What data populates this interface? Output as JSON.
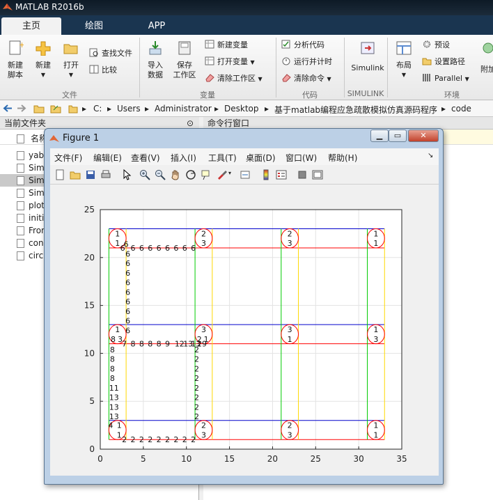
{
  "app": {
    "title": "MATLAB R2016b"
  },
  "tabs": [
    {
      "label": "主页",
      "active": true
    },
    {
      "label": "绘图",
      "active": false
    },
    {
      "label": "APP",
      "active": false
    }
  ],
  "ribbon": {
    "new_script": "新建\n脚本",
    "new": "新建",
    "open": "打开",
    "find_files": "查找文件",
    "compare": "比较",
    "import_data": "导入\n数据",
    "save_workspace": "保存\n工作区",
    "new_variable": "新建变量",
    "open_variable": "打开变量",
    "clear_workspace": "清除工作区",
    "analyze_code": "分析代码",
    "run_and_time": "运行并计时",
    "clear_commands": "清除命令",
    "simulink": "Simulink",
    "layout": "布局",
    "preferences": "预设",
    "set_path": "设置路径",
    "parallel": "Parallel",
    "addons": "附加",
    "groups": {
      "file": "文件",
      "variable": "变量",
      "code": "代码",
      "simulink": "SIMULINK",
      "environment": "环境"
    }
  },
  "address": {
    "crumbs": [
      "C:",
      "Users",
      "Administrator",
      "Desktop",
      "基于matlab编程应急疏散模拟仿真源码程序",
      "code"
    ]
  },
  "current_folder": {
    "header": "当前文件夹",
    "name_col": "名称",
    "files": [
      "yab",
      "Sim",
      "Sim",
      "Sim",
      "plot",
      "initi",
      "Fron",
      "con",
      "circ"
    ],
    "selected_index": 2
  },
  "command_window": {
    "header": "命令行窗口"
  },
  "figure": {
    "title": "Figure 1",
    "menu": [
      "文件(F)",
      "编辑(E)",
      "查看(V)",
      "插入(I)",
      "工具(T)",
      "桌面(D)",
      "窗口(W)",
      "帮助(H)"
    ],
    "toolbar_icons": [
      "new-figure-icon",
      "open-icon",
      "save-icon",
      "print-icon",
      "pointer-icon",
      "zoom-in-icon",
      "zoom-out-icon",
      "pan-icon",
      "rotate-icon",
      "data-cursor-icon",
      "brush-icon",
      "link-icon",
      "colorbar-icon",
      "legend-icon",
      "hide-tools-icon",
      "dock-icon"
    ]
  },
  "chart_data": {
    "type": "scatter",
    "title": "",
    "xlabel": "",
    "ylabel": "",
    "xlim": [
      0,
      35
    ],
    "ylim": [
      0,
      25
    ],
    "xticks": [
      0,
      5,
      10,
      15,
      20,
      25,
      30,
      35
    ],
    "yticks": [
      0,
      5,
      10,
      15,
      20,
      25
    ],
    "grid": true,
    "lines": [
      {
        "color": "#0000cc",
        "x": [
          1,
          33
        ],
        "y": [
          23,
          23
        ]
      },
      {
        "color": "#ff0000",
        "x": [
          1,
          33
        ],
        "y": [
          21,
          21
        ]
      },
      {
        "color": "#0000cc",
        "x": [
          1,
          33
        ],
        "y": [
          13,
          13
        ]
      },
      {
        "color": "#ff0000",
        "x": [
          1,
          33
        ],
        "y": [
          11,
          11
        ]
      },
      {
        "color": "#0000cc",
        "x": [
          1,
          33
        ],
        "y": [
          3,
          3
        ]
      },
      {
        "color": "#ff0000",
        "x": [
          1,
          33
        ],
        "y": [
          1,
          1
        ]
      },
      {
        "color": "#00cc00",
        "x": [
          1,
          1
        ],
        "y": [
          1,
          23
        ]
      },
      {
        "color": "#ffd800",
        "x": [
          3,
          3
        ],
        "y": [
          1,
          23
        ]
      },
      {
        "color": "#00cc00",
        "x": [
          11,
          11
        ],
        "y": [
          1,
          23
        ]
      },
      {
        "color": "#ffd800",
        "x": [
          13,
          13
        ],
        "y": [
          1,
          23
        ]
      },
      {
        "color": "#00cc00",
        "x": [
          21,
          21
        ],
        "y": [
          1,
          23
        ]
      },
      {
        "color": "#ffd800",
        "x": [
          23,
          23
        ],
        "y": [
          1,
          23
        ]
      },
      {
        "color": "#00cc00",
        "x": [
          31,
          31
        ],
        "y": [
          1,
          23
        ]
      },
      {
        "color": "#ffd800",
        "x": [
          33,
          33
        ],
        "y": [
          1,
          23
        ]
      }
    ],
    "circles": [
      {
        "cx": 2,
        "cy": 22,
        "r": 1
      },
      {
        "cx": 12,
        "cy": 22,
        "r": 1
      },
      {
        "cx": 22,
        "cy": 22,
        "r": 1
      },
      {
        "cx": 32,
        "cy": 22,
        "r": 1
      },
      {
        "cx": 2,
        "cy": 12,
        "r": 1
      },
      {
        "cx": 12,
        "cy": 12,
        "r": 1
      },
      {
        "cx": 22,
        "cy": 12,
        "r": 1
      },
      {
        "cx": 32,
        "cy": 12,
        "r": 1
      },
      {
        "cx": 2,
        "cy": 2,
        "r": 1
      },
      {
        "cx": 12,
        "cy": 2,
        "r": 1
      },
      {
        "cx": 22,
        "cy": 2,
        "r": 1
      },
      {
        "cx": 32,
        "cy": 2,
        "r": 1
      }
    ],
    "labels": [
      {
        "x": 2,
        "y": 22.5,
        "t": "1"
      },
      {
        "x": 2,
        "y": 21.5,
        "t": "1"
      },
      {
        "x": 12,
        "y": 22.5,
        "t": "2"
      },
      {
        "x": 12,
        "y": 21.5,
        "t": "3"
      },
      {
        "x": 22,
        "y": 22.5,
        "t": "2"
      },
      {
        "x": 22,
        "y": 21.5,
        "t": "3"
      },
      {
        "x": 32,
        "y": 22.5,
        "t": "1"
      },
      {
        "x": 32,
        "y": 21.5,
        "t": "1"
      },
      {
        "x": 2,
        "y": 12.5,
        "t": "1"
      },
      {
        "x": 1.5,
        "y": 11.5,
        "t": "8"
      },
      {
        "x": 2.3,
        "y": 11.5,
        "t": "3"
      },
      {
        "x": 12,
        "y": 12.5,
        "t": "3"
      },
      {
        "x": 11.5,
        "y": 11.5,
        "t": "2"
      },
      {
        "x": 12.3,
        "y": 11.5,
        "t": "1"
      },
      {
        "x": 22,
        "y": 12.5,
        "t": "3"
      },
      {
        "x": 22,
        "y": 11.5,
        "t": "1"
      },
      {
        "x": 32,
        "y": 12.5,
        "t": "1"
      },
      {
        "x": 32,
        "y": 11.5,
        "t": "3"
      },
      {
        "x": 1.2,
        "y": 2.5,
        "t": "4"
      },
      {
        "x": 2.2,
        "y": 2.5,
        "t": "1"
      },
      {
        "x": 2.2,
        "y": 1.5,
        "t": "1"
      },
      {
        "x": 12,
        "y": 2.5,
        "t": "2"
      },
      {
        "x": 12,
        "y": 1.5,
        "t": "3"
      },
      {
        "x": 22,
        "y": 2.5,
        "t": "2"
      },
      {
        "x": 22,
        "y": 1.5,
        "t": "3"
      },
      {
        "x": 32,
        "y": 2.5,
        "t": "1"
      },
      {
        "x": 32,
        "y": 1.5,
        "t": "1"
      },
      {
        "x": 3,
        "y": 21.4,
        "t": "6"
      },
      {
        "x": 3.8,
        "y": 21,
        "t": "6"
      },
      {
        "x": 4.8,
        "y": 21,
        "t": "6"
      },
      {
        "x": 5.8,
        "y": 21,
        "t": "6"
      },
      {
        "x": 6.8,
        "y": 21,
        "t": "6"
      },
      {
        "x": 7.8,
        "y": 21,
        "t": "6"
      },
      {
        "x": 8.8,
        "y": 21,
        "t": "6"
      },
      {
        "x": 9.8,
        "y": 21,
        "t": "6"
      },
      {
        "x": 10.8,
        "y": 21,
        "t": "6"
      },
      {
        "x": 2.6,
        "y": 21,
        "t": "6"
      },
      {
        "x": 3.2,
        "y": 20.4,
        "t": "6"
      },
      {
        "x": 3.2,
        "y": 19.4,
        "t": "6"
      },
      {
        "x": 3.2,
        "y": 18.4,
        "t": "6"
      },
      {
        "x": 3.2,
        "y": 17.4,
        "t": "6"
      },
      {
        "x": 3.2,
        "y": 16.4,
        "t": "6"
      },
      {
        "x": 3.2,
        "y": 15.4,
        "t": "6"
      },
      {
        "x": 3.2,
        "y": 14.4,
        "t": "6"
      },
      {
        "x": 3.2,
        "y": 13.4,
        "t": "6"
      },
      {
        "x": 3.2,
        "y": 12.4,
        "t": "6"
      },
      {
        "x": 2.8,
        "y": 11,
        "t": "7"
      },
      {
        "x": 3.8,
        "y": 11,
        "t": "8"
      },
      {
        "x": 4.8,
        "y": 11,
        "t": "8"
      },
      {
        "x": 5.8,
        "y": 11,
        "t": "8"
      },
      {
        "x": 6.8,
        "y": 11,
        "t": "8"
      },
      {
        "x": 7.8,
        "y": 11,
        "t": "9"
      },
      {
        "x": 9.2,
        "y": 11,
        "t": "12"
      },
      {
        "x": 10.2,
        "y": 11,
        "t": "13"
      },
      {
        "x": 11.1,
        "y": 11,
        "t": "13"
      },
      {
        "x": 11.8,
        "y": 11,
        "t": "29"
      },
      {
        "x": 1.4,
        "y": 10.4,
        "t": "8"
      },
      {
        "x": 1.4,
        "y": 9.4,
        "t": "8"
      },
      {
        "x": 1.4,
        "y": 8.4,
        "t": "8"
      },
      {
        "x": 1.4,
        "y": 7.4,
        "t": "8"
      },
      {
        "x": 1.6,
        "y": 6.4,
        "t": "11"
      },
      {
        "x": 1.6,
        "y": 5.4,
        "t": "13"
      },
      {
        "x": 1.6,
        "y": 4.4,
        "t": "13"
      },
      {
        "x": 1.6,
        "y": 3.4,
        "t": "13"
      },
      {
        "x": 11.2,
        "y": 10.4,
        "t": "2"
      },
      {
        "x": 11.2,
        "y": 9.4,
        "t": "2"
      },
      {
        "x": 11.2,
        "y": 8.4,
        "t": "2"
      },
      {
        "x": 11.2,
        "y": 7.4,
        "t": "2"
      },
      {
        "x": 11.2,
        "y": 6.4,
        "t": "2"
      },
      {
        "x": 11.2,
        "y": 5.4,
        "t": "2"
      },
      {
        "x": 11.2,
        "y": 4.4,
        "t": "2"
      },
      {
        "x": 11.2,
        "y": 3.4,
        "t": "2"
      },
      {
        "x": 2.8,
        "y": 1,
        "t": "2"
      },
      {
        "x": 3.8,
        "y": 1,
        "t": "2"
      },
      {
        "x": 4.8,
        "y": 1,
        "t": "2"
      },
      {
        "x": 5.8,
        "y": 1,
        "t": "2"
      },
      {
        "x": 6.8,
        "y": 1,
        "t": "2"
      },
      {
        "x": 7.8,
        "y": 1,
        "t": "2"
      },
      {
        "x": 8.8,
        "y": 1,
        "t": "2"
      },
      {
        "x": 9.8,
        "y": 1,
        "t": "2"
      },
      {
        "x": 10.8,
        "y": 1,
        "t": "2"
      }
    ]
  }
}
